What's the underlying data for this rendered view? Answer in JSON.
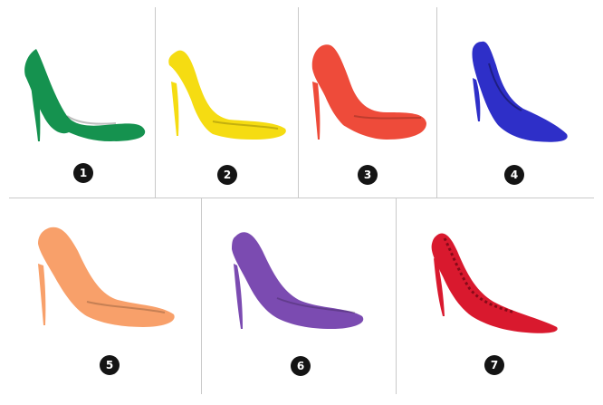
{
  "shoes": [
    {
      "label": "1",
      "color": "#15924f",
      "icon": "green-pump-shoe"
    },
    {
      "label": "2",
      "color": "#f5dc12",
      "icon": "yellow-pump-shoe"
    },
    {
      "label": "3",
      "color": "#ee4b3a",
      "icon": "red-orange-pump-shoe"
    },
    {
      "label": "4",
      "color": "#2e2fc8",
      "icon": "blue-pump-shoe"
    },
    {
      "label": "5",
      "color": "#f8a06a",
      "icon": "orange-pump-shoe"
    },
    {
      "label": "6",
      "color": "#7b4bb1",
      "icon": "purple-pump-shoe"
    },
    {
      "label": "7",
      "color": "#d9192e",
      "icon": "red-ruffled-pump-shoe"
    }
  ],
  "grid_color": "#c9c9c9",
  "badge_color": "#141414"
}
